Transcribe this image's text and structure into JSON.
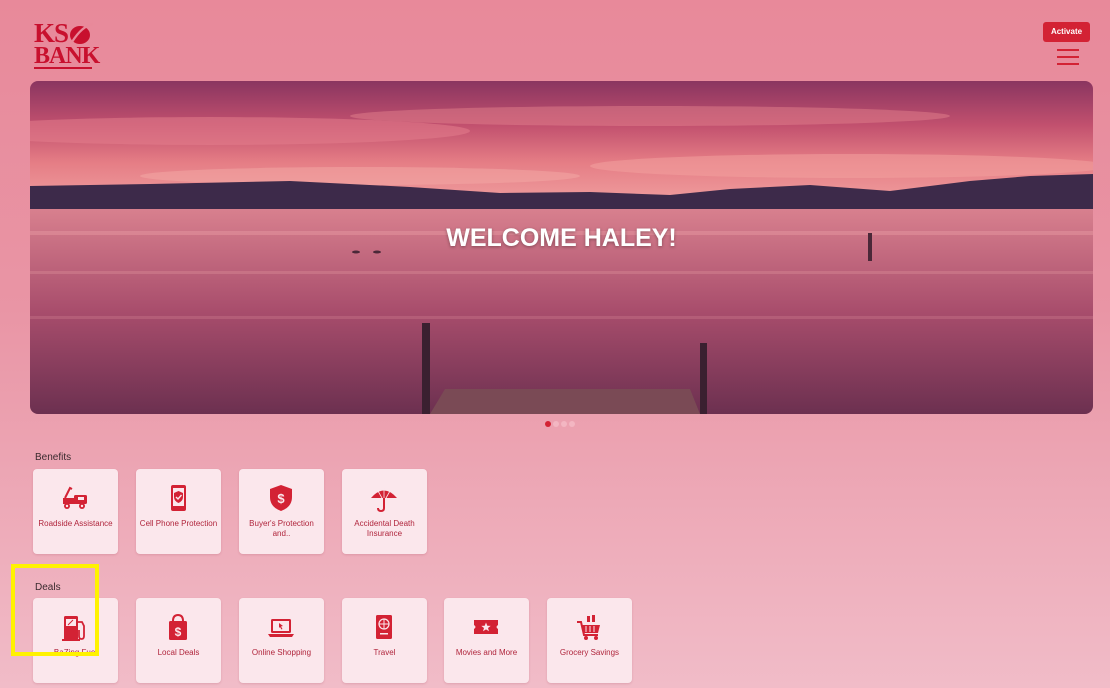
{
  "app": {
    "logo": {
      "line1": "KS",
      "line2": "BANK"
    },
    "activate_label": "Activate",
    "menu_icon": "hamburger-menu-icon"
  },
  "hero": {
    "title": "WELCOME HALEY!",
    "carousel": {
      "total_slides": 4,
      "active_slide": 1
    }
  },
  "benefits": {
    "title": "Benefits",
    "items": [
      {
        "label": "Roadside Assistance",
        "icon": "tow-truck-icon"
      },
      {
        "label": "Cell Phone Protection",
        "icon": "phone-shield-icon"
      },
      {
        "label": "Buyer's Protection and..",
        "icon": "dollar-shield-icon"
      },
      {
        "label": "Accidental Death Insurance",
        "icon": "umbrella-icon"
      }
    ]
  },
  "deals": {
    "title": "Deals",
    "items": [
      {
        "label": "BaZing Fuel",
        "icon": "fuel-pump-icon"
      },
      {
        "label": "Local Deals",
        "icon": "shopping-bag-icon"
      },
      {
        "label": "Online Shopping",
        "icon": "laptop-icon"
      },
      {
        "label": "Travel",
        "icon": "passport-icon"
      },
      {
        "label": "Movies and More",
        "icon": "ticket-icon"
      },
      {
        "label": "Grocery Savings",
        "icon": "grocery-cart-icon"
      }
    ]
  },
  "colors": {
    "brand_red": "#d32234",
    "card_bg": "#fbe7ec",
    "highlight": "#fff200"
  }
}
